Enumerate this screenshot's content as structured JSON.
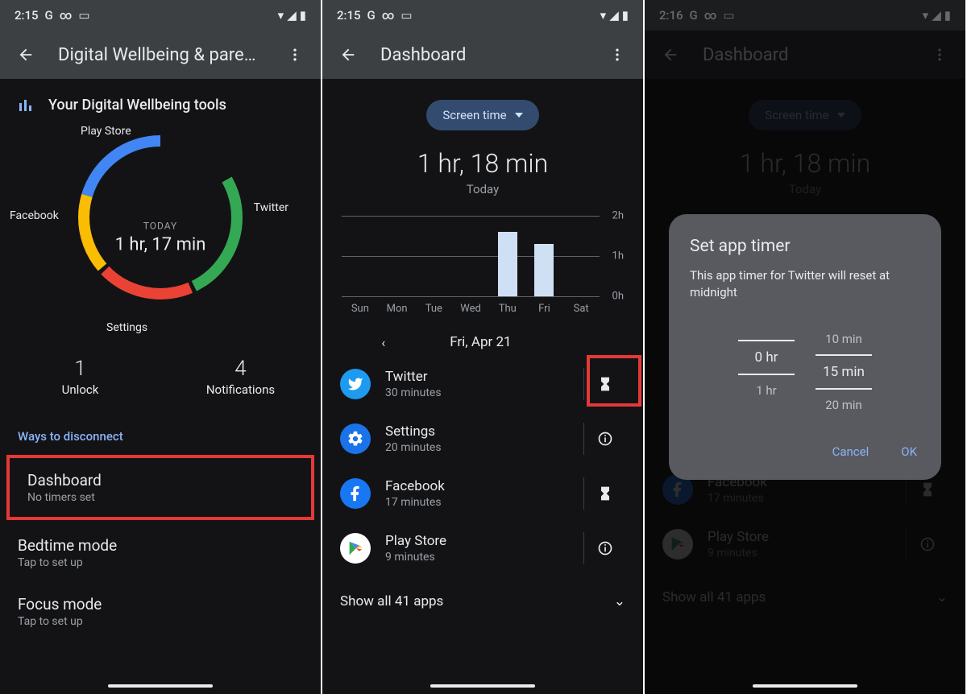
{
  "screen1": {
    "status_time": "2:15",
    "title": "Digital Wellbeing & parental...",
    "tools_header": "Your Digital Wellbeing tools",
    "donut": {
      "center_label": "TODAY",
      "center_value": "1 hr, 17 min",
      "segments": [
        "Play Store",
        "Twitter",
        "Settings",
        "Facebook"
      ]
    },
    "stats": [
      {
        "num": "1",
        "label": "Unlock"
      },
      {
        "num": "4",
        "label": "Notifications"
      }
    ],
    "ways_header": "Ways to disconnect",
    "rows": [
      {
        "title": "Dashboard",
        "sub": "No timers set"
      },
      {
        "title": "Bedtime mode",
        "sub": "Tap to set up"
      },
      {
        "title": "Focus mode",
        "sub": "Tap to set up"
      }
    ]
  },
  "screen2": {
    "status_time": "2:15",
    "title": "Dashboard",
    "chip": "Screen time",
    "total": "1 hr, 18 min",
    "today": "Today",
    "y_ticks": [
      "2h",
      "1h",
      "0h"
    ],
    "days": [
      "Sun",
      "Mon",
      "Tue",
      "Wed",
      "Thu",
      "Fri",
      "Sat"
    ],
    "date": "Fri, Apr 21",
    "apps": [
      {
        "name": "Twitter",
        "duration": "30 minutes",
        "action": "hourglass"
      },
      {
        "name": "Settings",
        "duration": "20 minutes",
        "action": "info"
      },
      {
        "name": "Facebook",
        "duration": "17 minutes",
        "action": "hourglass"
      },
      {
        "name": "Play Store",
        "duration": "9 minutes",
        "action": "info"
      }
    ],
    "show_all": "Show all 41 apps"
  },
  "screen3": {
    "status_time": "2:16",
    "title": "Dashboard",
    "chip": "Screen time",
    "total": "1 hr, 18 min",
    "today": "Today",
    "apps_visible": [
      {
        "name": "Facebook",
        "duration": "17 minutes",
        "action": "hourglass"
      },
      {
        "name": "Play Store",
        "duration": "9 minutes",
        "action": "info"
      }
    ],
    "show_all": "Show all 41 apps",
    "dialog": {
      "title": "Set app timer",
      "body": "This app timer for Twitter will reset at midnight",
      "hours": {
        "above": "",
        "sel": "0 hr",
        "below": "1 hr"
      },
      "mins": {
        "above": "10 min",
        "sel": "15 min",
        "below": "20 min"
      },
      "cancel": "Cancel",
      "ok": "OK"
    }
  },
  "chart_data": {
    "type": "bar",
    "categories": [
      "Sun",
      "Mon",
      "Tue",
      "Wed",
      "Thu",
      "Fri",
      "Sat"
    ],
    "values": [
      0,
      0,
      0,
      0,
      1.6,
      1.3,
      0
    ],
    "ylabel": "hours",
    "ylim": [
      0,
      2
    ],
    "title": "Screen time — Fri, Apr 21"
  }
}
